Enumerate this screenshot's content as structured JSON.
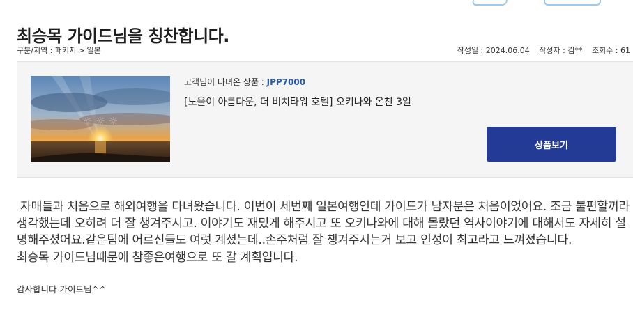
{
  "review": {
    "title": "최승목 가이드님을 칭찬합니다.",
    "category_label": "구분/지역 : 패키지",
    "region": "일본",
    "date": "작성일 : 2024.06.04",
    "author": "작성자 : 김**",
    "views": "조회수 : 61",
    "body": " 자매들과 처음으로 해외여행을 다녀왔습니다. 이번이 세번째 일본여행인데 가이드가 남자분은 처음이었어요. 조금 불편할꺼라 생각했는데 오히려 더 잘 챙겨주시고. 이야기도 재밌게 해주시고 또 오키나와에 대해 몰랐던 역사이야기에 대해서도 자세히 설명해주셨어요.같은팀에 어르신들도 여럿 계셨는데..손주처럼 잘 챙겨주시는거 보고 인성이 최고라고 느껴졌습니다.\n최승목 가이드님때문에 참좋은여행으로 또 갈 계획입니다.",
    "signoff": "감사합니다 가이드님^^"
  },
  "product": {
    "code_label": "고객님이 다녀온 상품 : ",
    "code": "JPP7000",
    "name": "[노을이 아름다운, 더 비치타워 호텔] 오키나와 온천 3일",
    "button_label": "상품보기"
  }
}
